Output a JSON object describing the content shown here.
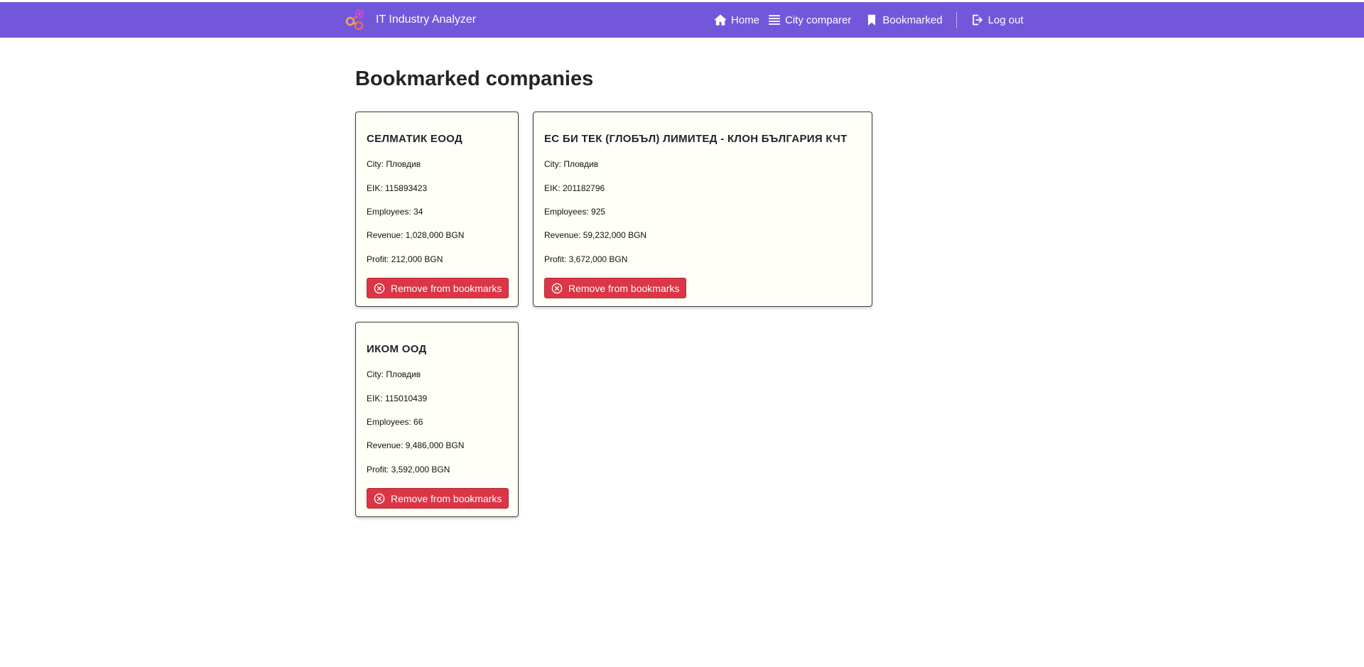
{
  "app": {
    "title": "IT Industry Analyzer"
  },
  "nav": {
    "home": "Home",
    "city_comparer": "City comparer",
    "bookmarked": "Bookmarked",
    "logout": "Log out"
  },
  "page": {
    "title": "Bookmarked companies"
  },
  "companies": [
    {
      "name": "СЕЛМАТИК ЕООД",
      "city": "City: Пловдив",
      "eik": "EIK: 115893423",
      "employees": "Employees: 34",
      "revenue": "Revenue: 1,028,000 BGN",
      "profit": "Profit: 212,000 BGN",
      "remove_label": "Remove from bookmarks"
    },
    {
      "name": "ЕС БИ ТЕК (ГЛОБЪЛ) ЛИМИТЕД - КЛОН БЪЛГАРИЯ КЧТ",
      "city": "City: Пловдив",
      "eik": "EIK: 201182796",
      "employees": "Employees: 925",
      "revenue": "Revenue: 59,232,000 BGN",
      "profit": "Profit: 3,672,000 BGN",
      "remove_label": "Remove from bookmarks"
    },
    {
      "name": "ИКОМ ООД",
      "city": "City: Пловдив",
      "eik": "EIK: 115010439",
      "employees": "Employees: 66",
      "revenue": "Revenue: 9,486,000 BGN",
      "profit": "Profit: 3,592,000 BGN",
      "remove_label": "Remove from bookmarks"
    }
  ],
  "colors": {
    "navbar": "#7257db",
    "remove_button": "#dc3545",
    "card_background": "#fffff8"
  },
  "icons": {
    "logo": "app-logo-icon",
    "home": "home-icon",
    "city_comparer": "list-icon",
    "bookmarked": "bookmark-icon",
    "logout": "logout-icon",
    "remove": "circle-x-icon"
  }
}
